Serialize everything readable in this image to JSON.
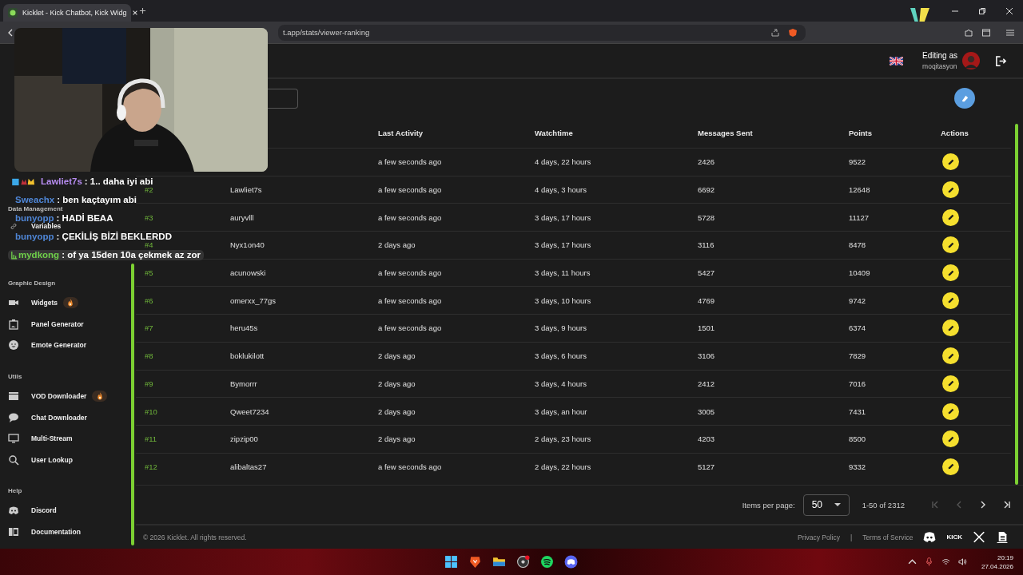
{
  "browser": {
    "tab": {
      "title": "Kicklet - Kick Chatbot, Kick Widg",
      "selected": true
    },
    "url": "t.app/stats/viewer-ranking"
  },
  "header": {
    "editing_label": "Editing as",
    "username": "moqitasyon"
  },
  "sidebar": [
    {
      "title": "Data Management",
      "items": [
        {
          "label": "Variables",
          "hot": false
        }
      ]
    },
    {
      "title": "Graphic Design",
      "items": [
        {
          "label": "Widgets",
          "hot": true
        },
        {
          "label": "Panel Generator",
          "hot": false
        },
        {
          "label": "Emote Generator",
          "hot": false
        }
      ]
    },
    {
      "title": "Utils",
      "items": [
        {
          "label": "VOD Downloader",
          "hot": true
        },
        {
          "label": "Chat Downloader",
          "hot": false
        },
        {
          "label": "Multi-Stream",
          "hot": false
        },
        {
          "label": "User Lookup",
          "hot": false
        }
      ]
    },
    {
      "title": "Help",
      "items": [
        {
          "label": "Discord",
          "hot": false
        },
        {
          "label": "Documentation",
          "hot": false
        }
      ]
    }
  ],
  "table": {
    "columns": [
      "Last Activity",
      "Watchtime",
      "Messages Sent",
      "Points",
      "Actions"
    ],
    "rows": [
      {
        "last_activity": "a few seconds ago",
        "watchtime": "4 days, 22 hours",
        "messages": "2426",
        "points": "9522"
      },
      {
        "rank": "#2",
        "user": "Lawliet7s",
        "last_activity": "a few seconds ago",
        "watchtime": "4 days, 3 hours",
        "messages": "6692",
        "points": "12648"
      },
      {
        "rank": "#3",
        "user": "auryvlll",
        "last_activity": "a few seconds ago",
        "watchtime": "3 days, 17 hours",
        "messages": "5728",
        "points": "11127"
      },
      {
        "rank": "#4",
        "user": "Nyx1on40",
        "last_activity": "2 days ago",
        "watchtime": "3 days, 17 hours",
        "messages": "3116",
        "points": "8478"
      },
      {
        "rank": "#5",
        "user": "acunowski",
        "last_activity": "a few seconds ago",
        "watchtime": "3 days, 11 hours",
        "messages": "5427",
        "points": "10409"
      },
      {
        "rank": "#6",
        "user": "omerxx_77gs",
        "last_activity": "a few seconds ago",
        "watchtime": "3 days, 10 hours",
        "messages": "4769",
        "points": "9742"
      },
      {
        "rank": "#7",
        "user": "heru45s",
        "last_activity": "a few seconds ago",
        "watchtime": "3 days, 9 hours",
        "messages": "1501",
        "points": "6374"
      },
      {
        "rank": "#8",
        "user": "boklukilott",
        "last_activity": "2 days ago",
        "watchtime": "3 days, 6 hours",
        "messages": "3106",
        "points": "7829"
      },
      {
        "rank": "#9",
        "user": "Bymorrr",
        "last_activity": "2 days ago",
        "watchtime": "3 days, 4 hours",
        "messages": "2412",
        "points": "7016"
      },
      {
        "rank": "#10",
        "user": "Qweet7234",
        "last_activity": "2 days ago",
        "watchtime": "3 days, an hour",
        "messages": "3005",
        "points": "7431"
      },
      {
        "rank": "#11",
        "user": "zipzip00",
        "last_activity": "2 days ago",
        "watchtime": "2 days, 23 hours",
        "messages": "4203",
        "points": "8500"
      },
      {
        "rank": "#12",
        "user": "alibaltas27",
        "last_activity": "a few seconds ago",
        "watchtime": "2 days, 22 hours",
        "messages": "5127",
        "points": "9332"
      }
    ]
  },
  "pagination": {
    "label": "Items per page:",
    "page_size": "50",
    "range": "1-50 of 2312",
    "first_disabled": true,
    "prev_disabled": true,
    "next_disabled": false,
    "last_disabled": false
  },
  "footer": {
    "copyright": "© 2026 Kicklet. All rights reserved.",
    "links": [
      "Privacy Policy",
      "Terms of Service"
    ],
    "separator": "|",
    "kick_logo": "KICK"
  },
  "chat": [
    {
      "user": "Lawliet7s",
      "message": ": 1.. daha iyi abi",
      "color": "#b68cf0",
      "highlighted": false
    },
    {
      "user": "Sweachx",
      "message": ": ben kaçtayım abi",
      "color": "#4f86d6",
      "highlighted": false
    },
    {
      "user": "bunyopp",
      "message": ": HADİ BEAA",
      "color": "#4f86d6",
      "highlighted": false
    },
    {
      "user": "bunyopp",
      "message": ": ÇEKİLİŞ BİZİ BEKLERDD",
      "color": "#4f86d6",
      "highlighted": false
    },
    {
      "user": "mydkong",
      "message": ": of ya 15den 10a çekmek az zor",
      "color": "#6fcf4a",
      "highlighted": true
    }
  ],
  "taskbar": {
    "time": "20:19",
    "date": "27.04.2026"
  }
}
